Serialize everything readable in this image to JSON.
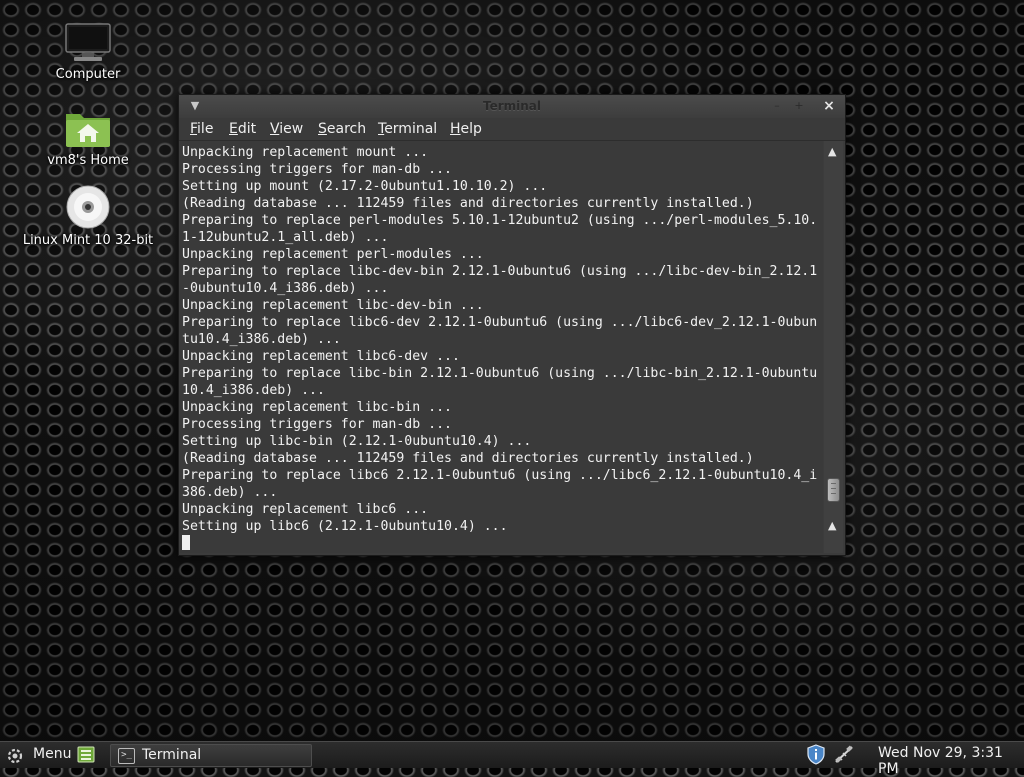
{
  "desktop": {
    "icons": [
      {
        "label": "Computer",
        "icon": "computer-icon"
      },
      {
        "label": "vm8's Home",
        "icon": "home-folder-icon"
      },
      {
        "label": "Linux Mint 10 32-bit",
        "icon": "disc-icon"
      }
    ]
  },
  "window": {
    "title": "Terminal",
    "menu": [
      "File",
      "Edit",
      "View",
      "Search",
      "Terminal",
      "Help"
    ],
    "output": [
      "Unpacking replacement mount ...",
      "Processing triggers for man-db ...",
      "Setting up mount (2.17.2-0ubuntu1.10.10.2) ...",
      "(Reading database ... 112459 files and directories currently installed.)",
      "Preparing to replace perl-modules 5.10.1-12ubuntu2 (using .../perl-modules_5.10.",
      "1-12ubuntu2.1_all.deb) ...",
      "Unpacking replacement perl-modules ...",
      "Preparing to replace libc-dev-bin 2.12.1-0ubuntu6 (using .../libc-dev-bin_2.12.1",
      "-0ubuntu10.4_i386.deb) ...",
      "Unpacking replacement libc-dev-bin ...",
      "Preparing to replace libc6-dev 2.12.1-0ubuntu6 (using .../libc6-dev_2.12.1-0ubun",
      "tu10.4_i386.deb) ...",
      "Unpacking replacement libc6-dev ...",
      "Preparing to replace libc-bin 2.12.1-0ubuntu6 (using .../libc-bin_2.12.1-0ubuntu",
      "10.4_i386.deb) ...",
      "Unpacking replacement libc-bin ...",
      "Processing triggers for man-db ...",
      "Setting up libc-bin (2.12.1-0ubuntu10.4) ...",
      "(Reading database ... 112459 files and directories currently installed.)",
      "Preparing to replace libc6 2.12.1-0ubuntu6 (using .../libc6_2.12.1-0ubuntu10.4_i",
      "386.deb) ...",
      "Unpacking replacement libc6 ...",
      "Setting up libc6 (2.12.1-0ubuntu10.4) ..."
    ],
    "scroll_position": 0.95
  },
  "panel": {
    "menu_label": "Menu",
    "task_label": "Terminal",
    "clock": "Wed Nov 29,  3:31 PM"
  },
  "colors": {
    "terminal_bg": "#3a3a3a",
    "terminal_fg": "#f2f2f2",
    "folder_green": "#8cc152"
  }
}
